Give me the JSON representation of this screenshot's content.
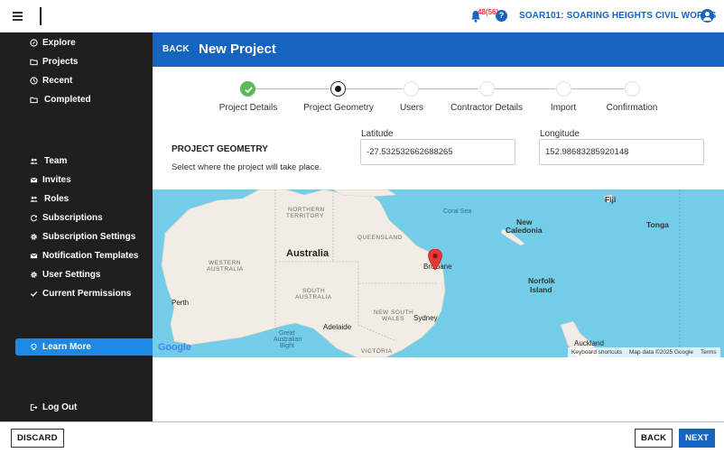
{
  "topbar": {
    "notification_count": "48(56)",
    "org_name": "SOAR101: SOARING HEIGHTS CIVIL WORKS",
    "help_glyph": "?"
  },
  "sidebar": {
    "items": [
      {
        "label": "Explore",
        "icon": "compass-icon"
      },
      {
        "label": "Projects",
        "icon": "folder-icon"
      },
      {
        "label": "Recent",
        "icon": "clock-icon"
      },
      {
        "label": "Completed",
        "icon": "folder-check-icon"
      },
      {
        "label": "Team",
        "icon": "people-icon"
      },
      {
        "label": "Invites",
        "icon": "envelope-icon"
      },
      {
        "label": "Roles",
        "icon": "people-icon"
      },
      {
        "label": "Subscriptions",
        "icon": "refresh-icon"
      },
      {
        "label": "Subscription Settings",
        "icon": "gear-icon"
      },
      {
        "label": "Notification Templates",
        "icon": "envelope-icon"
      },
      {
        "label": "User Settings",
        "icon": "gear-icon"
      },
      {
        "label": "Current Permissions",
        "icon": "check-icon"
      }
    ],
    "learn_more": "Learn More",
    "logout": "Log Out"
  },
  "header": {
    "back": "BACK",
    "title": "New Project"
  },
  "stepper": {
    "steps": [
      {
        "label": "Project Details",
        "state": "done"
      },
      {
        "label": "Project Geometry",
        "state": "active"
      },
      {
        "label": "Users",
        "state": "pending"
      },
      {
        "label": "Contractor Details",
        "state": "pending"
      },
      {
        "label": "Import",
        "state": "pending"
      },
      {
        "label": "Confirmation",
        "state": "pending"
      }
    ]
  },
  "geometry": {
    "title": "PROJECT GEOMETRY",
    "description": "Select where the project will take place.",
    "latitude_label": "Latitude",
    "latitude_value": "-27.532532662688265",
    "longitude_label": "Longitude",
    "longitude_value": "152.98683285920148"
  },
  "map": {
    "labels": {
      "northern_territory_1": "NORTHERN",
      "northern_territory_2": "TERRITORY",
      "queensland": "QUEENSLAND",
      "western_australia_1": "WESTERN",
      "western_australia_2": "AUSTRALIA",
      "australia": "Australia",
      "south_australia_1": "SOUTH",
      "south_australia_2": "AUSTRALIA",
      "new_south_wales_1": "NEW SOUTH",
      "new_south_wales_2": "WALES",
      "victoria": "VICTORIA",
      "coral_sea": "Coral Sea",
      "new_caledonia_1": "New",
      "new_caledonia_2": "Caledonia",
      "fiji": "Fiji",
      "tonga": "Tonga",
      "norfolk_island_1": "Norfolk",
      "norfolk_island_2": "Island",
      "brisbane": "Brisbane",
      "sydney": "Sydney",
      "perth": "Perth",
      "adelaide": "Adelaide",
      "great_australian_bight_1": "Great",
      "great_australian_bight_2": "Australian",
      "great_australian_bight_3": "Bight",
      "auckland": "Auckland"
    },
    "google": "Google",
    "footer": {
      "shortcuts": "Keyboard shortcuts",
      "data": "Map data ©2025 Google",
      "terms": "Terms"
    }
  },
  "footer": {
    "discard": "DISCARD",
    "back": "BACK",
    "next": "NEXT"
  },
  "colors": {
    "brand_blue": "#1565c0",
    "sidebar_bg": "#1f1f1f",
    "step_done": "#5cb85c",
    "map_water": "#74cde8",
    "map_land": "#f1ede4"
  }
}
